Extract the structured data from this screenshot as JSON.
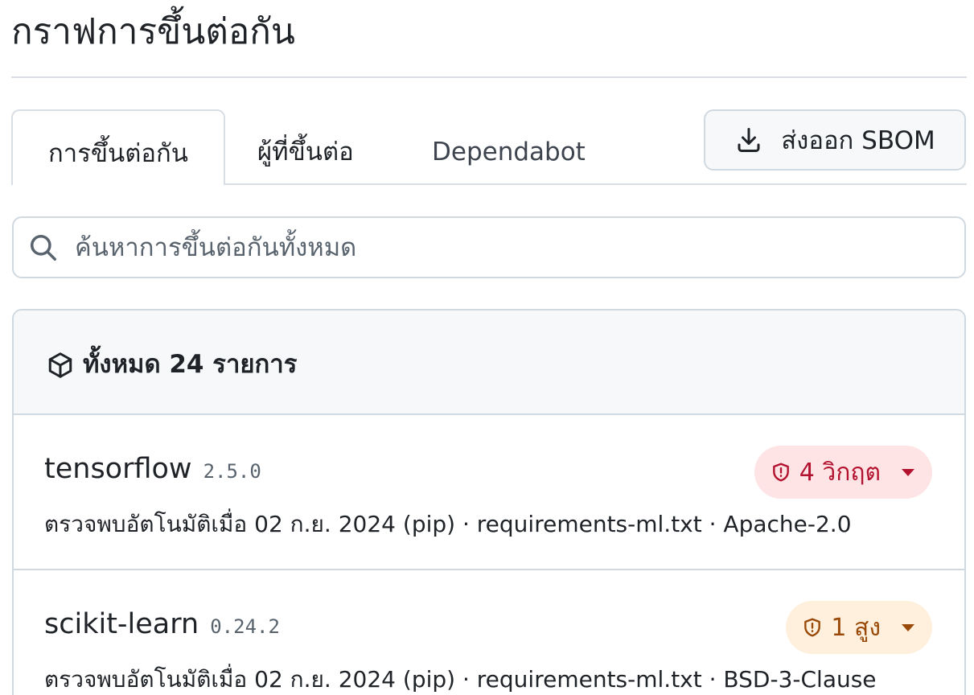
{
  "page": {
    "title": "กราฟการขึ้นต่อกัน"
  },
  "tabs": [
    {
      "label": "การขึ้นต่อกัน",
      "active": true
    },
    {
      "label": "ผู้ที่ขึ้นต่อ",
      "active": false
    },
    {
      "label": "Dependabot",
      "active": false
    }
  ],
  "toolbar": {
    "export_label": "ส่งออก SBOM"
  },
  "search": {
    "placeholder": "ค้นหาการขึ้นต่อกันทั้งหมด",
    "value": ""
  },
  "results": {
    "count_label": "ทั้งหมด 24 รายการ",
    "items": [
      {
        "name": "tensorflow",
        "version": "2.5.0",
        "meta": "ตรวจพบอัตโนมัติเมื่อ 02 ก.ย. 2024 (pip) · requirements-ml.txt · Apache-2.0",
        "severity_label": "4 วิกฤต",
        "severity_color": "#b3122f"
      },
      {
        "name": "scikit-learn",
        "version": "0.24.2",
        "meta": "ตรวจพบอัตโนมัติเมื่อ 02 ก.ย. 2024 (pip) · requirements-ml.txt · BSD-3-Clause",
        "severity_label": "1 สูง",
        "severity_color": "#9a4a08"
      }
    ]
  },
  "icons": {
    "search": "search-icon",
    "download": "download-icon",
    "package": "package-icon",
    "shield": "shield-icon",
    "caret": "caret-down-icon"
  }
}
